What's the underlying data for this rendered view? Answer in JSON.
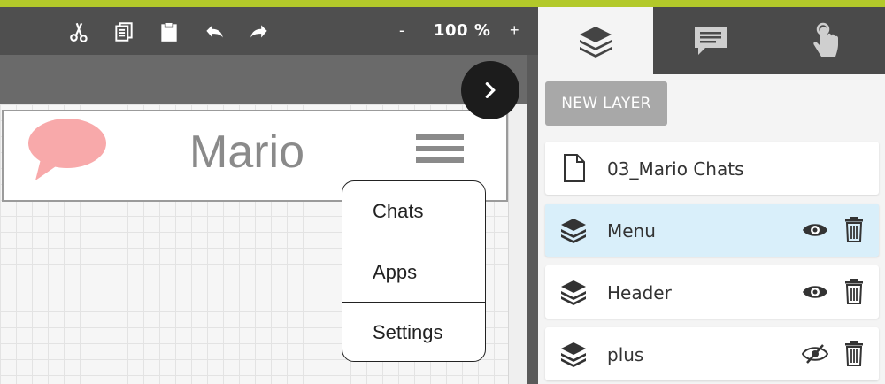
{
  "colors": {
    "accent": "#b3c92a",
    "selected_row": "#d9effa",
    "bubble": "#f8a9aa"
  },
  "toolbar": {
    "icons": [
      "scissors-icon",
      "copy-icon",
      "paste-icon",
      "undo-icon",
      "redo-icon"
    ],
    "zoom_minus": "-",
    "zoom_value": "100 %",
    "zoom_plus": "+"
  },
  "canvas": {
    "header_title": "Mario",
    "menu_items": [
      "Chats",
      "Apps",
      "Settings"
    ]
  },
  "right_panel": {
    "tabs": [
      "layers-icon",
      "comment-icon",
      "touch-icon"
    ],
    "new_layer_label": "NEW LAYER",
    "layers": [
      {
        "name": "03_Mario Chats",
        "icon": "page-icon",
        "visible": null
      },
      {
        "name": "Menu",
        "icon": "layers-icon",
        "visible": true,
        "selected": true
      },
      {
        "name": "Header",
        "icon": "layers-icon",
        "visible": true
      },
      {
        "name": "plus",
        "icon": "layers-icon",
        "visible": false
      }
    ]
  }
}
